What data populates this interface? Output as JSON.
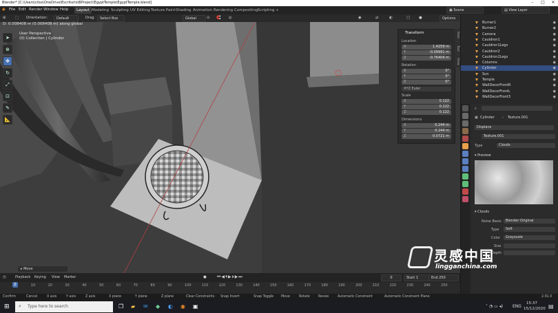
{
  "title_bar": {
    "text": "Blender* [C:\\Users\\ctiss\\OneDrive\\Escritorio\\BProject\\EgyptTemple\\EgyptTemple.blend]"
  },
  "menu": [
    "File",
    "Edit",
    "Render",
    "Window",
    "Help"
  ],
  "workspaces": [
    "Layout",
    "Modeling",
    "Sculpting",
    "UV Editing",
    "Texture Paint",
    "Shading",
    "Animation",
    "Rendering",
    "Compositing",
    "Scripting",
    "+"
  ],
  "active_workspace": "Layout",
  "scene": "Scene",
  "view_layer": "View Layer",
  "viewport_header": {
    "orientation_label": "Orientation:",
    "orientation_value": "Default",
    "drag_label": "Drag",
    "select_box": "Select Box",
    "transform_space": "Global",
    "options": "Options"
  },
  "viewport_info": {
    "line1": "D: 0.008408 m (0.008408 m) along global",
    "line2": "User Perspective",
    "line3": "(0) Collection | Cylinder"
  },
  "npanel": {
    "title": "Transform",
    "location_label": "Location",
    "location": [
      {
        "axis": "X",
        "value": "1.4259 m"
      },
      {
        "axis": "Y",
        "value": "-0.09991 m"
      },
      {
        "axis": "Z",
        "value": "-0.76404 m"
      }
    ],
    "rotation_label": "Rotation",
    "rotation": [
      {
        "axis": "X",
        "value": "0°"
      },
      {
        "axis": "Y",
        "value": "0°"
      },
      {
        "axis": "Z",
        "value": "0°"
      }
    ],
    "rotation_mode": "XYZ Euler",
    "scale_label": "Scale",
    "scale": [
      {
        "axis": "X",
        "value": "0.122"
      },
      {
        "axis": "Y",
        "value": "0.122"
      },
      {
        "axis": "Z",
        "value": "0.122"
      }
    ],
    "dimensions_label": "Dimensions",
    "dimensions": [
      {
        "axis": "X",
        "value": "0.244 m"
      },
      {
        "axis": "Y",
        "value": "0.244 m"
      },
      {
        "axis": "Z",
        "value": "0.0721 m"
      }
    ],
    "tabs": [
      "Item",
      "Tool",
      "View"
    ]
  },
  "move_panel": "Move",
  "timeline": {
    "menu": [
      "Playback",
      "Keying",
      "View",
      "Marker"
    ],
    "current_frame": "0",
    "start_label": "Start",
    "start": "1",
    "end_label": "End",
    "end": "250",
    "ticks": [
      "0",
      "10",
      "20",
      "30",
      "40",
      "50",
      "60",
      "70",
      "80",
      "90",
      "100",
      "110",
      "120",
      "130",
      "140",
      "150",
      "160",
      "170",
      "180",
      "190",
      "200",
      "210",
      "220",
      "230",
      "240",
      "250"
    ]
  },
  "statusbar": [
    "Confirm",
    "Cancel",
    "X axis",
    "Y axis",
    "Z axis",
    "X plane",
    "Y plane",
    "Z plane",
    "Clear Constraints",
    "Snap Invert",
    "Snap Toggle",
    "Move",
    "Rotate",
    "Resize",
    "Automatic Constraint",
    "Automatic Constraint Plane"
  ],
  "version": "2.91.0",
  "outliner": {
    "items": [
      {
        "name": "Burner1",
        "selected": false
      },
      {
        "name": "Burner2",
        "selected": false
      },
      {
        "name": "Camera",
        "selected": false
      },
      {
        "name": "Cauldron1",
        "selected": false
      },
      {
        "name": "Cauldron1Legs",
        "selected": false
      },
      {
        "name": "Cauldron2",
        "selected": false
      },
      {
        "name": "Cauldron2Legs",
        "selected": false
      },
      {
        "name": "Columns",
        "selected": false
      },
      {
        "name": "Cylinder",
        "selected": true
      },
      {
        "name": "Sun",
        "selected": false
      },
      {
        "name": "Temple",
        "selected": false
      },
      {
        "name": "WallDecorFrontR",
        "selected": false
      },
      {
        "name": "WallDecorFrontL",
        "selected": false
      },
      {
        "name": "WallDecorFront3",
        "selected": false
      }
    ]
  },
  "properties": {
    "breadcrumb_object": "Cylinder",
    "breadcrumb_texture": "Texture.001",
    "modifier": "Displace",
    "texture_name": "Texture.001",
    "type_label": "Type",
    "type_value": "Clouds",
    "preview_label": "Preview",
    "clouds_label": "Clouds",
    "noise_basis_label": "Noise Basis",
    "noise_basis": "Blender Original",
    "noise_type_label": "Type",
    "noise_type": "Soft",
    "color_label": "Color",
    "color": "Grayscale",
    "size_label": "Size",
    "depth_label": "Depth"
  },
  "taskbar": {
    "search_placeholder": "Type here to search",
    "time": "15:37",
    "date": "15/12/2020",
    "lang": "ENG"
  },
  "watermark": {
    "brand": "灵感中国",
    "url": "lingganchina.com"
  },
  "colors": {
    "accent": "#4772b3",
    "selection": "#334d80",
    "object_orange": "#e8a04a",
    "modifier_green": "#5fbf7a"
  }
}
